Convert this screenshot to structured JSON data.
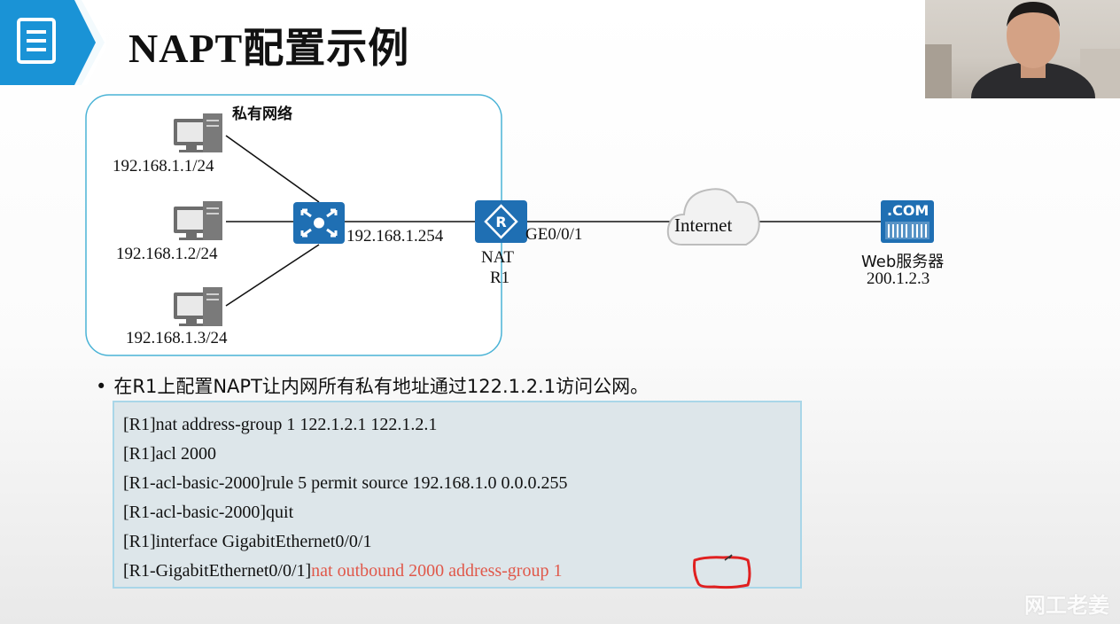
{
  "slide": {
    "title": "NAPT配置示例",
    "icon": "document-list-icon"
  },
  "diagram": {
    "private_network_label": "私有网络",
    "hosts": [
      {
        "ip": "192.168.1.1/24"
      },
      {
        "ip": "192.168.1.2/24"
      },
      {
        "ip": "192.168.1.3/24"
      }
    ],
    "switch_icon": "switch-icon",
    "router_inside_ip": "192.168.1.254",
    "router_outside_if": "GE0/0/1",
    "router_label_1": "NAT",
    "router_label_2": "R1",
    "cloud_label": "Internet",
    "server_badge": ".COM",
    "server_label": "Web服务器",
    "server_ip": "200.1.2.3"
  },
  "bullet": {
    "text": "在R1上配置NAPT让内网所有私有地址通过122.1.2.1访问公网。"
  },
  "code": {
    "lines": [
      "[R1]nat address-group 1 122.1.2.1 122.1.2.1",
      "[R1]acl 2000",
      "[R1-acl-basic-2000]rule 5 permit source 192.168.1.0 0.0.0.255",
      "[R1-acl-basic-2000]quit",
      "[R1]interface GigabitEthernet0/0/1"
    ],
    "last_prefix": "[R1-GigabitEthernet0/0/1]",
    "last_highlight": "nat outbound 2000 address-group 1"
  },
  "colors": {
    "accent_blue": "#1a93d6",
    "device_blue": "#1f6fb3",
    "highlight_red": "#e0584a",
    "annotation_red": "#e02020"
  },
  "watermark": {
    "text": "网工老姜"
  }
}
